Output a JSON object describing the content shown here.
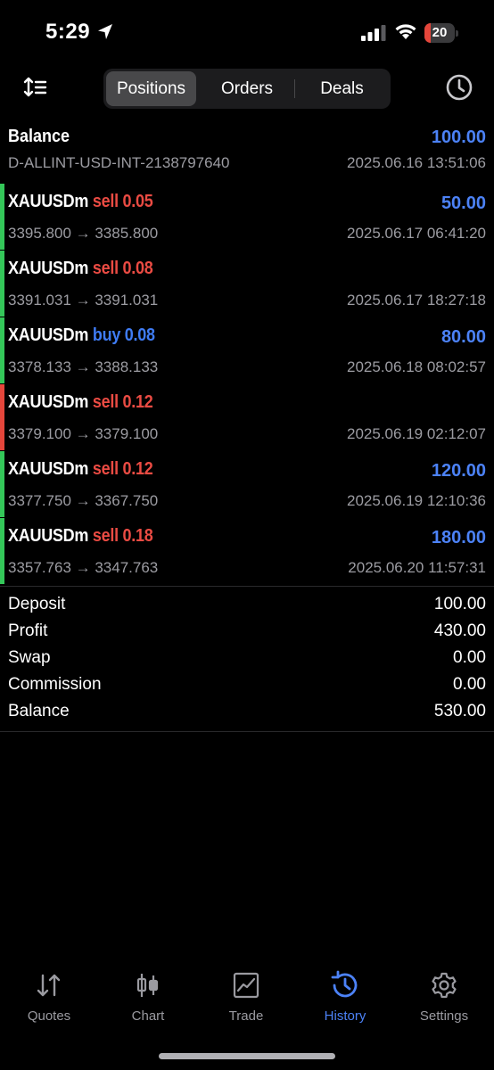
{
  "status_bar": {
    "time": "5:29",
    "battery": "20",
    "battery_level": 0.2
  },
  "toolbar": {
    "tabs": [
      {
        "label": "Positions"
      },
      {
        "label": "Orders"
      },
      {
        "label": "Deals"
      }
    ],
    "active_tab": "Positions"
  },
  "balance_entry": {
    "title": "Balance",
    "amount": "100.00",
    "account": "D-ALLINT-USD-INT-2138797640",
    "time": "2025.06.16 13:51:06"
  },
  "deals": [
    {
      "symbol": "XAUUSDm",
      "side": "sell",
      "volume": "0.05",
      "profit": "50.00",
      "prices": "3395.800 → 3385.800",
      "time": "2025.06.17 06:41:20",
      "bar_color": "#34c759"
    },
    {
      "symbol": "XAUUSDm",
      "side": "sell",
      "volume": "0.08",
      "profit": "",
      "prices": "3391.031 → 3391.031",
      "time": "2025.06.17 18:27:18",
      "bar_color": "#34c759"
    },
    {
      "symbol": "XAUUSDm",
      "side": "buy",
      "volume": "0.08",
      "profit": "80.00",
      "prices": "3378.133 → 3388.133",
      "time": "2025.06.18 08:02:57",
      "bar_color": "#34c759"
    },
    {
      "symbol": "XAUUSDm",
      "side": "sell",
      "volume": "0.12",
      "profit": "",
      "prices": "3379.100 → 3379.100",
      "time": "2025.06.19 02:12:07",
      "bar_color": "#e5463b"
    },
    {
      "symbol": "XAUUSDm",
      "side": "sell",
      "volume": "0.12",
      "profit": "120.00",
      "prices": "3377.750 → 3367.750",
      "time": "2025.06.19 12:10:36",
      "bar_color": "#34c759"
    },
    {
      "symbol": "XAUUSDm",
      "side": "sell",
      "volume": "0.18",
      "profit": "180.00",
      "prices": "3357.763 → 3347.763",
      "time": "2025.06.20 11:57:31",
      "bar_color": "#34c759"
    }
  ],
  "summary": [
    {
      "label": "Deposit",
      "value": "100.00"
    },
    {
      "label": "Profit",
      "value": "430.00"
    },
    {
      "label": "Swap",
      "value": "0.00"
    },
    {
      "label": "Commission",
      "value": "0.00"
    },
    {
      "label": "Balance",
      "value": "530.00"
    }
  ],
  "tabbar": {
    "items": [
      {
        "label": "Quotes",
        "icon": "quotes-icon"
      },
      {
        "label": "Chart",
        "icon": "chart-icon"
      },
      {
        "label": "Trade",
        "icon": "trade-icon"
      },
      {
        "label": "History",
        "icon": "history-icon"
      },
      {
        "label": "Settings",
        "icon": "settings-icon"
      }
    ],
    "active": "History"
  },
  "colors": {
    "accent": "#4c82f7",
    "sell": "#ea4b43",
    "buy": "#3f7cf5",
    "profit_bar": "#34c759",
    "loss_bar": "#e5463b"
  }
}
